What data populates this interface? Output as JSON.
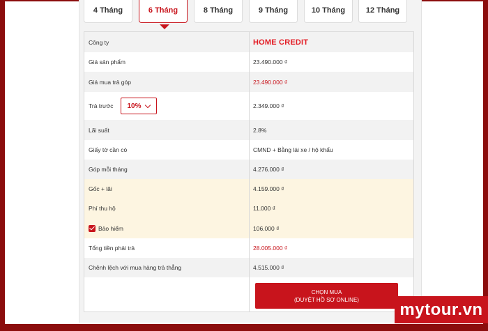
{
  "tabs": [
    {
      "label": "4 Tháng",
      "active": false
    },
    {
      "label": "6 Tháng",
      "active": true
    },
    {
      "label": "8 Tháng",
      "active": false
    },
    {
      "label": "9 Tháng",
      "active": false
    },
    {
      "label": "10 Tháng",
      "active": false
    },
    {
      "label": "12 Tháng",
      "active": false
    }
  ],
  "company": {
    "label": "Công ty",
    "logo_text": "HOME CREDIT"
  },
  "rows": {
    "price": {
      "label": "Giá sản phẩm",
      "value": "23.490.000 ₫"
    },
    "installment_price": {
      "label": "Giá mua trả góp",
      "value": "23.490.000 ₫"
    },
    "prepay": {
      "label": "Trả trước",
      "select_value": "10%",
      "value": "2.349.000 ₫"
    },
    "interest": {
      "label": "Lãi suất",
      "value": "2.8%"
    },
    "documents": {
      "label": "Giấy tờ cần có",
      "value": "CMND + Bằng lái xe / hộ khẩu"
    },
    "monthly": {
      "label": "Góp mỗi tháng",
      "value": "4.276.000 ₫"
    },
    "principal_interest": {
      "label": "Gốc + lãi",
      "value": "4.159.000 ₫"
    },
    "collection_fee": {
      "label": "Phí thu hộ",
      "value": "11.000 ₫"
    },
    "insurance": {
      "label": "Bảo hiểm",
      "checked": true,
      "value": "106.000 ₫"
    },
    "total": {
      "label": "Tổng tiền phải trả",
      "value": "28.005.000 ₫"
    },
    "difference": {
      "label": "Chênh lệch với mua hàng trả thẳng",
      "value": "4.515.000 ₫"
    }
  },
  "cta": {
    "line1": "CHỌN MUA",
    "line2": "(DUYỆT HỒ SƠ ONLINE)"
  },
  "watermark": "mytour.vn",
  "colors": {
    "accent": "#c8141c",
    "frame": "#8b0d0d",
    "highlight_row": "#fdf5e1"
  }
}
